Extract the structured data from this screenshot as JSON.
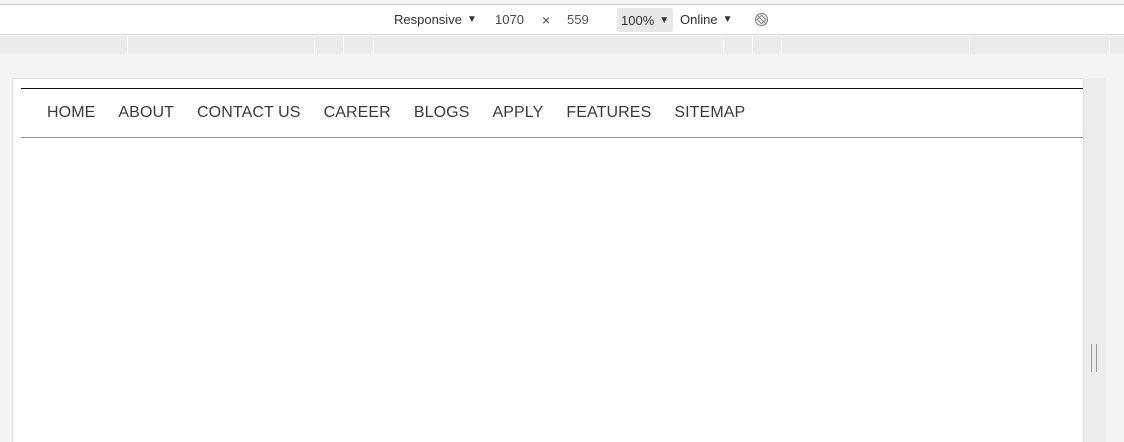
{
  "toolbar": {
    "device_mode": "Responsive",
    "width": "1070",
    "times": "×",
    "height": "559",
    "zoom": "100%",
    "throttle": "Online",
    "rotate_icon": "rotate-disabled-icon",
    "caret": "▼"
  },
  "nav": {
    "items": [
      {
        "label": "HOME"
      },
      {
        "label": "ABOUT"
      },
      {
        "label": "CONTACT US"
      },
      {
        "label": "CAREER"
      },
      {
        "label": "BLOGS"
      },
      {
        "label": "APPLY"
      },
      {
        "label": "FEATURES"
      },
      {
        "label": "SITEMAP"
      }
    ]
  },
  "colors": {
    "nav_text": "#3a3a3a",
    "nav_top_border": "#111111",
    "nav_bottom_border": "#a78a8f"
  }
}
